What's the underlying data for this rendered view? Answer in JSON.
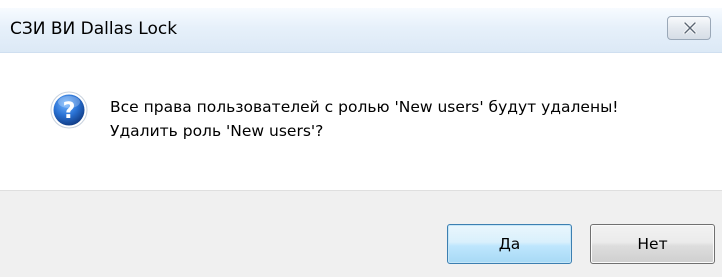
{
  "window": {
    "title": "СЗИ ВИ Dallas Lock",
    "close_icon": "close-icon"
  },
  "message": {
    "icon": "question-icon",
    "line1": "Все права пользователей с ролью 'New users' будут удалены!",
    "line2": "Удалить роль 'New users'?"
  },
  "buttons": {
    "yes_label": "Да",
    "no_label": "Нет"
  },
  "colors": {
    "title_bar": "#dce9f6",
    "button_bar": "#f0f0f0",
    "default_button_border": "#3c7fb1",
    "icon_blue": "#1f5fb8"
  }
}
